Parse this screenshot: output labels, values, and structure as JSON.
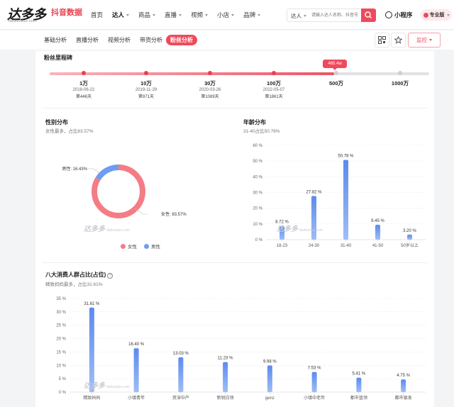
{
  "header": {
    "logo_main": "达多多",
    "logo_sub": "抖音数据",
    "logo_url": "daduoduo.com",
    "nav": [
      {
        "label": "首页",
        "caret": false,
        "active": false
      },
      {
        "label": "达人",
        "caret": true,
        "active": true
      },
      {
        "label": "商品",
        "caret": true,
        "active": false
      },
      {
        "label": "直播",
        "caret": true,
        "active": false
      },
      {
        "label": "视频",
        "caret": true,
        "active": false
      },
      {
        "label": "小店",
        "caret": true,
        "active": false
      },
      {
        "label": "品牌",
        "caret": true,
        "active": false
      }
    ],
    "search_select": "达人",
    "search_placeholder": "请输入达人名称、抖音号",
    "mini_program": "小程序",
    "pro_label": "专业版"
  },
  "subnav": {
    "tabs": [
      "基础分析",
      "直播分析",
      "视频分析",
      "带货分析",
      "粉丝分析"
    ],
    "active_index": 4,
    "monitor_label": "监控"
  },
  "milestone": {
    "title": "粉丝里程碑",
    "bubble": "485.4w",
    "progress_fraction": 0.75,
    "points": [
      {
        "label": "1万",
        "date": "2018-06-22",
        "days": "第446天",
        "reached": true
      },
      {
        "label": "10万",
        "date": "2019-11-29",
        "days": "第971天",
        "reached": true
      },
      {
        "label": "30万",
        "date": "2020-03-26",
        "days": "第1089天",
        "reached": true
      },
      {
        "label": "100万",
        "date": "2022-05-07",
        "days": "第1861天",
        "reached": true
      },
      {
        "label": "500万",
        "date": "",
        "days": "",
        "reached": false
      },
      {
        "label": "1000万",
        "date": "",
        "days": "",
        "reached": false
      }
    ]
  },
  "gender": {
    "title": "性别分布",
    "subtitle": "女性最多，占比83.57%",
    "legend": [
      "女性",
      "男性"
    ],
    "male_label": "男性: 16.43%",
    "female_label": "女性: 83.57%"
  },
  "age": {
    "title": "年龄分布",
    "subtitle": "31-40占比50.78%"
  },
  "consumer": {
    "title": "八大消费人群占比(占位)",
    "subtitle": "精致妈妈最多，占比31.61%"
  },
  "watermark": {
    "main": "达多多",
    "sub": "daduoduo.com"
  },
  "colors": {
    "accent": "#ef4a5c",
    "female": "#f47d85",
    "male": "#6f9cf1",
    "bar": "#6a96f0"
  },
  "chart_data": [
    {
      "type": "pie",
      "categories": [
        "女性",
        "男性"
      ],
      "values": [
        83.57,
        16.43
      ],
      "title": "性别分布"
    },
    {
      "type": "bar",
      "title": "年龄分布",
      "categories": [
        "18-23",
        "24-30",
        "31-40",
        "41-50",
        "50岁以上"
      ],
      "values": [
        8.72,
        27.82,
        50.78,
        9.45,
        3.2
      ],
      "ylim": [
        0,
        60
      ],
      "yticks": [
        "0 %",
        "10 %",
        "20 %",
        "30 %",
        "40 %",
        "50 %",
        "60 %"
      ],
      "data_labels": [
        "8.72 %",
        "27.82 %",
        "50.78 %",
        "9.45 %",
        "3.20 %"
      ]
    },
    {
      "type": "bar",
      "title": "八大消费人群占比",
      "categories": [
        "精致妈妈",
        "小镇青年",
        "资深中产",
        "新锐白领",
        "genz",
        "小镇中老年",
        "都市蓝领",
        "都市银发"
      ],
      "values": [
        31.61,
        16.4,
        13.03,
        11.23,
        9.98,
        7.53,
        5.41,
        4.75
      ],
      "ylim": [
        0,
        35
      ],
      "yticks": [
        "0 %",
        "5 %",
        "10 %",
        "15 %",
        "20 %",
        "25 %",
        "30 %",
        "35 %"
      ],
      "data_labels": [
        "31.61 %",
        "16.40 %",
        "13.03 %",
        "11.23 %",
        "9.98 %",
        "7.53 %",
        "5.41 %",
        "4.75 %"
      ]
    }
  ]
}
